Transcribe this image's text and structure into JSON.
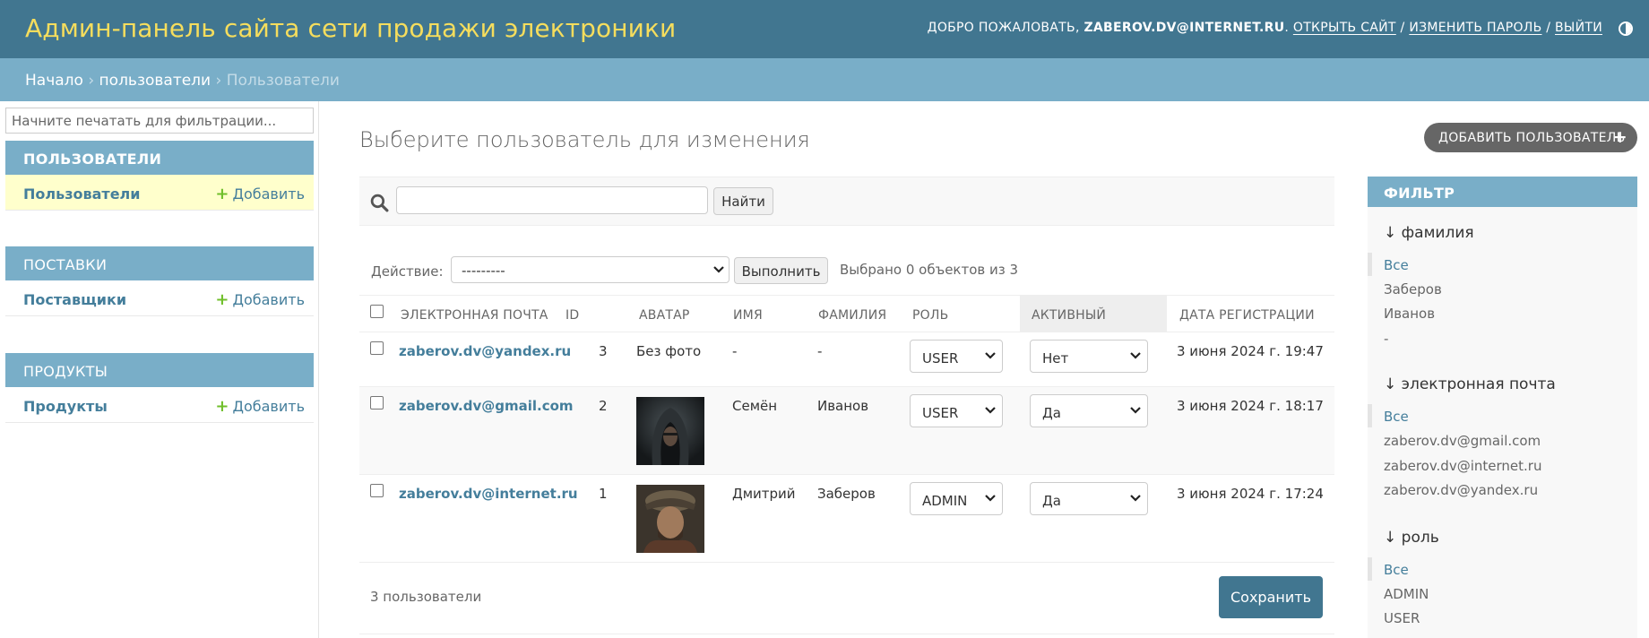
{
  "header": {
    "branding": "Админ-панель сайта сети продажи электроники",
    "welcome": "ДОБРО ПОЖАЛОВАТЬ, ",
    "username": "ZABEROV.DV@INTERNET.RU",
    "view_site": "ОТКРЫТЬ САЙТ",
    "change_password": "ИЗМЕНИТЬ ПАРОЛЬ",
    "logout": "ВЫЙТИ",
    "separator": " / ",
    "period": ". "
  },
  "breadcrumbs": {
    "home": "Начало",
    "app": "пользователи",
    "current": "Пользователи",
    "sep": " › "
  },
  "sidebar": {
    "filter_placeholder": "Начните печатать для фильтрации...",
    "apps": [
      {
        "caption": "ПОЛЬЗОВАТЕЛИ",
        "model": "Пользователи",
        "add": "Добавить"
      },
      {
        "caption": "ПОСТАВКИ",
        "model": "Поставщики",
        "add": "Добавить"
      },
      {
        "caption": "ПРОДУКТЫ",
        "model": "Продукты",
        "add": "Добавить"
      }
    ]
  },
  "content": {
    "title": "Выберите пользователь для изменения",
    "add_button": "ДОБАВИТЬ ПОЛЬЗОВАТЕЛЬ",
    "search_button": "Найти",
    "search_value": "",
    "action_label": "Действие:",
    "action_selected": "---------",
    "action_go": "Выполнить",
    "action_counter": "Выбрано 0 объектов из 3",
    "columns": [
      "ЭЛЕКТРОННАЯ ПОЧТА",
      "ID",
      "АВАТАР",
      "ИМЯ",
      "ФАМИЛИЯ",
      "РОЛЬ",
      "АКТИВНЫЙ",
      "ДАТА РЕГИСТРАЦИИ"
    ],
    "rows": [
      {
        "email": "zaberov.dv@yandex.ru",
        "id": "3",
        "avatar": "Без фото",
        "first_name": "-",
        "last_name": "-",
        "role": "USER",
        "active": "Нет",
        "date": "3 июня 2024 г. 19:47"
      },
      {
        "email": "zaberov.dv@gmail.com",
        "id": "2",
        "avatar": "",
        "first_name": "Семён",
        "last_name": "Иванов",
        "role": "USER",
        "active": "Да",
        "date": "3 июня 2024 г. 18:17"
      },
      {
        "email": "zaberov.dv@internet.ru",
        "id": "1",
        "avatar": "",
        "first_name": "Дмитрий",
        "last_name": "Заберов",
        "role": "ADMIN",
        "active": "Да",
        "date": "3 июня 2024 г. 17:24"
      }
    ],
    "paginator": "3 пользователи",
    "save_button": "Сохранить"
  },
  "filter": {
    "title": "ФИЛЬТР",
    "groups": [
      {
        "title": "↓ фамилия",
        "items": [
          "Все",
          "Заберов",
          "Иванов",
          "-"
        ]
      },
      {
        "title": "↓ электронная почта",
        "items": [
          "Все",
          "zaberov.dv@gmail.com",
          "zaberov.dv@internet.ru",
          "zaberov.dv@yandex.ru"
        ]
      },
      {
        "title": "↓ роль",
        "items": [
          "Все",
          "ADMIN",
          "USER"
        ]
      }
    ]
  },
  "colors": {
    "header": "#417690",
    "branding": "#f5dd5d",
    "breadcrumbs": "#79aec8",
    "link": "#447e9b",
    "current_model": "#ffffcc",
    "add_plus": "#70bf2b"
  },
  "icons": [
    "theme-toggle-icon",
    "search-icon",
    "plus-icon",
    "chevron-down-icon",
    "avatar-image"
  ]
}
